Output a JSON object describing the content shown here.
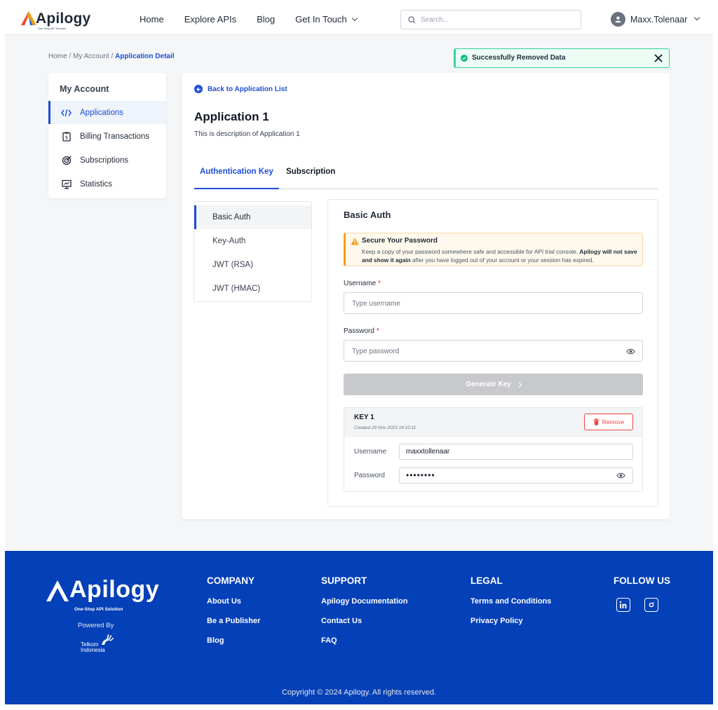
{
  "brand": {
    "name": "Apilogy",
    "tagline": "One-Stop API Solution"
  },
  "nav": {
    "items": [
      "Home",
      "Explore APIs",
      "Blog",
      "Get In Touch"
    ],
    "search_placeholder": "Search...",
    "user_name": "Maxx.Tolenaar"
  },
  "breadcrumb": {
    "home": "Home",
    "sep1": " / ",
    "account": "My Account",
    "sep2": " / ",
    "current": "Application Detail"
  },
  "toast": {
    "message": "Successfully Removed Data"
  },
  "sidebar": {
    "title": "My Account",
    "items": [
      {
        "label": "Applications",
        "icon": "code-icon"
      },
      {
        "label": "Billing Transactions",
        "icon": "receipt-icon"
      },
      {
        "label": "Subscriptions",
        "icon": "target-icon"
      },
      {
        "label": "Statistics",
        "icon": "presentation-icon"
      }
    ]
  },
  "main": {
    "back_label": "Back to Application List",
    "title": "Application 1",
    "description": "This is description of Application 1",
    "tabs": [
      "Authentication Key",
      "Subscription"
    ],
    "auth_methods": [
      "Basic Auth",
      "Key-Auth",
      "JWT (RSA)",
      "JWT (HMAC)"
    ]
  },
  "panel": {
    "title": "Basic Auth",
    "warning_title": "Secure Your Password",
    "warning_text_1": "Keep a copy of your password somewhere safe and accessible for API trial console. ",
    "warning_bold": "Apilogy will not save and show it again",
    "warning_text_2": " after you have logged out of your account or your session has expired.",
    "username_label": "Username",
    "username_placeholder": "Type username",
    "password_label": "Password",
    "password_placeholder": "Type password",
    "required_mark": "*",
    "generate_label": "Generate Key",
    "key": {
      "name": "KEY 1",
      "created": "Created 29 Nov 2023 14:10:11",
      "remove_label": "Remove",
      "username_label": "Username",
      "username_value": "maxxtollenaar",
      "password_label": "Password",
      "password_value": "••••••••"
    }
  },
  "footer": {
    "powered_by": "Powered By",
    "telkom": "Telkom Indonesia",
    "company": {
      "title": "COMPANY",
      "links": [
        "About Us",
        "Be a Publisher",
        "Blog"
      ]
    },
    "support": {
      "title": "SUPPORT",
      "links": [
        "Apilogy Documentation",
        "Contact Us",
        "FAQ"
      ]
    },
    "legal": {
      "title": "LEGAL",
      "links": [
        "Terms and Conditions",
        "Privacy Policy"
      ]
    },
    "follow": {
      "title": "FOLLOW US",
      "icons": [
        "linkedin-icon",
        "instagram-icon"
      ]
    },
    "copyright": "Copyright © 2024 Apilogy. All rights reserved."
  },
  "colors": {
    "primary": "#1d4ed8",
    "footer_bg": "#0440b7",
    "success": "#10b981",
    "danger": "#ef4444",
    "warning": "#f59e0b"
  }
}
